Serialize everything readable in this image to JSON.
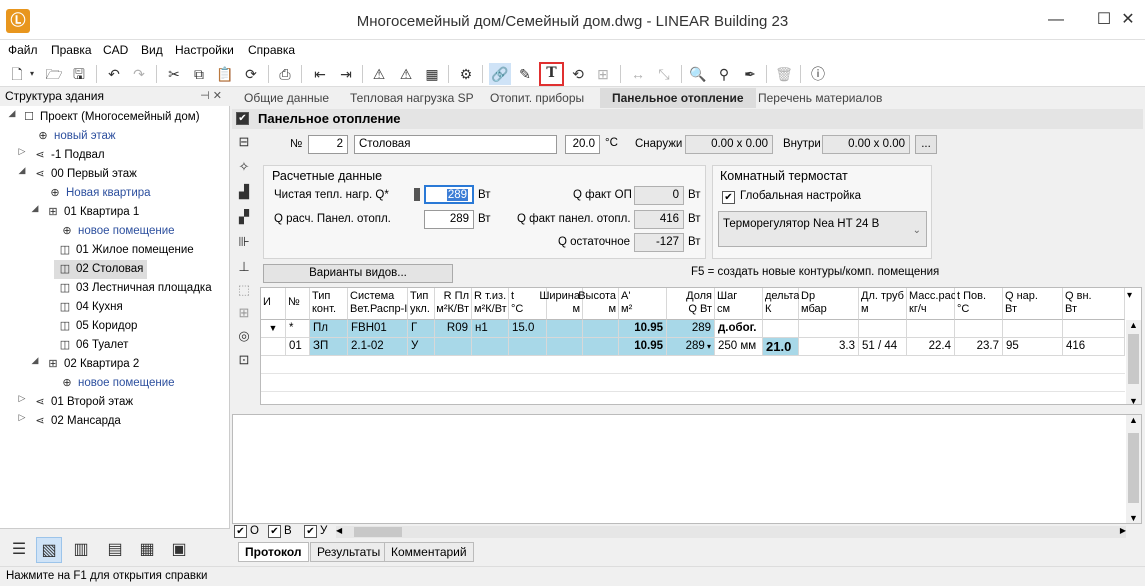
{
  "window": {
    "title": "Многосемейный дом/Семейный дом.dwg - LINEAR Building 23",
    "logo": "Ⓛ"
  },
  "menu": [
    "Файл",
    "Правка",
    "CAD",
    "Вид",
    "Настройки",
    "Справка"
  ],
  "sidebar": {
    "header": "Структура здания",
    "pin": "⊣ ✕",
    "tree": [
      {
        "label": "Проект (Многосемейный дом)",
        "icon": "☐"
      },
      {
        "label": "новый этаж",
        "icon": "⊕"
      },
      {
        "label": "-1 Подвал",
        "icon": "⋖"
      },
      {
        "label": "00 Первый этаж",
        "icon": "⋖"
      },
      {
        "label": "Новая квартира",
        "icon": "⊕"
      },
      {
        "label": "01 Квартира 1",
        "icon": "⊞"
      },
      {
        "label": "новое помещение",
        "icon": "⊕"
      },
      {
        "label": "01 Жилое помещение",
        "icon": "◫"
      },
      {
        "label": "02 Столовая",
        "icon": "◫"
      },
      {
        "label": "03 Лестничная площадка",
        "icon": "◫"
      },
      {
        "label": "04 Кухня",
        "icon": "◫"
      },
      {
        "label": "05 Коридор",
        "icon": "◫"
      },
      {
        "label": "06 Туалет",
        "icon": "◫"
      },
      {
        "label": "02 Квартира 2",
        "icon": "⊞"
      },
      {
        "label": "новое помещение",
        "icon": "⊕"
      },
      {
        "label": "01 Второй этаж",
        "icon": "⋖"
      },
      {
        "label": "02 Мансарда",
        "icon": "⋖"
      }
    ]
  },
  "tabs": [
    "Общие данные",
    "Тепловая нагрузка SP",
    "Отопит. приборы",
    "Панельное отопление",
    "Перечень материалов"
  ],
  "section": {
    "title": "Панельное отопление"
  },
  "room": {
    "no_label": "№",
    "no": "2",
    "name": "Столовая",
    "temp": "20.0",
    "temp_unit": "°C",
    "outside_label": "Снаружи",
    "outside": "0.00 x 0.00",
    "inside_label": "Внутри",
    "inside": "0.00 x 0.00",
    "more": "..."
  },
  "calc": {
    "title": "Расчетные данные",
    "net_label": "Чистая тепл. нагр. Q*",
    "net": "289",
    "net_unit": "Вт",
    "panel_label": "Q расч. Панел. отопл.",
    "panel": "289",
    "panel_unit": "Вт",
    "qfact_op_label": "Q факт ОП",
    "qfact_op": "0",
    "qfact_op_unit": "Вт",
    "qfact_panel_label": "Q факт панел. отопл.",
    "qfact_panel": "416",
    "qfact_panel_unit": "Вт",
    "qrest_label": "Q остаточное",
    "qrest": "-127",
    "qrest_unit": "Вт"
  },
  "thermostat": {
    "title": "Комнатный термостат",
    "global_label": "Глобальная настройка",
    "device": "Терморегулятор Nea HT 24 B"
  },
  "variants_button": "Варианты видов...",
  "f5_hint": "F5 = создать новые контуры/комп. помещения",
  "grid": {
    "headers": [
      [
        "И",
        ""
      ],
      [
        "№",
        ""
      ],
      [
        "Тип",
        "конт."
      ],
      [
        "Система",
        "Вет.Распр-I"
      ],
      [
        "Тип",
        "укл."
      ],
      [
        "R Пл",
        "м²К/Вт"
      ],
      [
        "R т.из.",
        "м²К/Вт"
      ],
      [
        "t",
        "°C"
      ],
      [
        "Ширина",
        "м"
      ],
      [
        "Высота",
        "м"
      ],
      [
        "A'",
        "м²"
      ],
      [
        "Доля",
        "Q Вт"
      ],
      [
        "Шаг",
        "см"
      ],
      [
        "дельта",
        "К"
      ],
      [
        "Dp",
        "мбар"
      ],
      [
        "Дл. труб",
        "м"
      ],
      [
        "Масс.расх",
        "кг/ч"
      ],
      [
        "t Пов.",
        "°C"
      ],
      [
        "Q нар.",
        "Вт"
      ],
      [
        "Q вн.",
        "Вт"
      ]
    ],
    "row1": [
      "",
      "*",
      "Пл",
      "FBH01",
      "Г",
      "R09",
      "н1",
      "15.0",
      "",
      "",
      "10.95",
      "289",
      "д.обог.",
      "",
      "",
      "",
      "",
      "",
      "",
      ""
    ],
    "row2": [
      "01",
      "ЗП",
      "2.1-02",
      "У",
      "",
      "",
      "",
      "",
      "",
      "10.95",
      "289",
      "250 мм",
      "21.0",
      "3.3",
      "51 / 44",
      "22.4",
      "23.7",
      "95",
      "416"
    ]
  },
  "filters": {
    "o": "О",
    "v": "В",
    "u": "У"
  },
  "bottom_tabs": [
    "Протокол",
    "Результаты",
    "Комментарий"
  ],
  "status": "Нажмите на F1 для открытия справки"
}
